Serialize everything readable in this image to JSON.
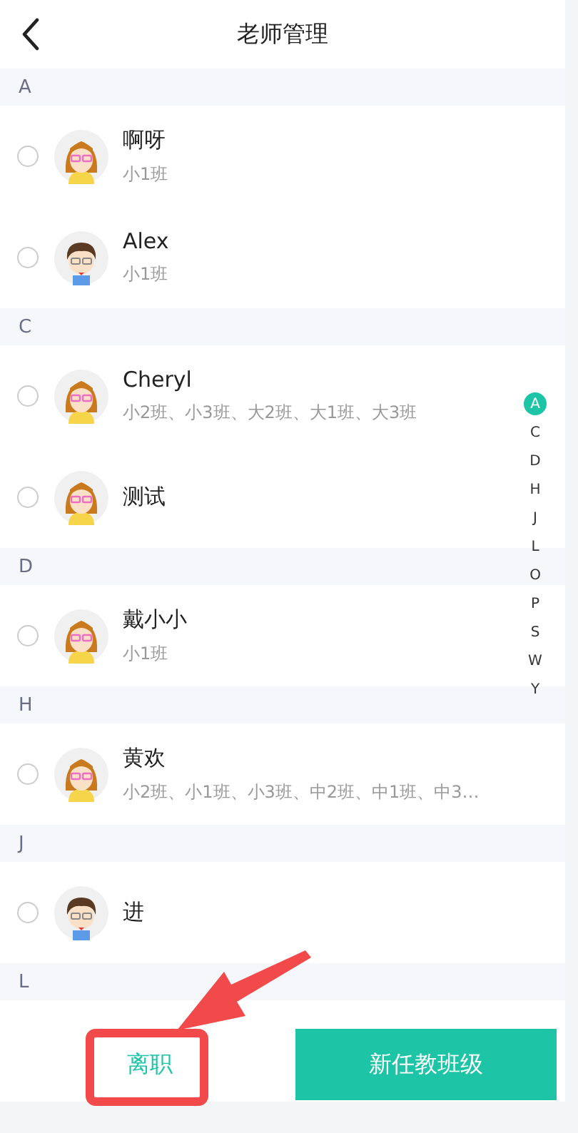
{
  "header": {
    "title": "老师管理"
  },
  "sections": [
    {
      "letter": "A",
      "teachers": [
        {
          "name": "啊呀",
          "classes": "小1班",
          "kind": "female",
          "checked": false
        },
        {
          "name": "Alex",
          "classes": "小1班",
          "kind": "male",
          "checked": false
        }
      ]
    },
    {
      "letter": "C",
      "teachers": [
        {
          "name": "Cheryl",
          "classes": "小2班、小3班、大2班、大1班、大3班",
          "kind": "female",
          "checked": false
        },
        {
          "name": "测试",
          "kind": "female",
          "checked": false
        }
      ]
    },
    {
      "letter": "D",
      "teachers": [
        {
          "name": "戴小小",
          "classes": "小1班",
          "kind": "female",
          "checked": false
        }
      ]
    },
    {
      "letter": "H",
      "teachers": [
        {
          "name": "黄欢",
          "classes": "小2班、小1班、小3班、中2班、中1班、中3…",
          "kind": "female",
          "checked": false
        }
      ]
    },
    {
      "letter": "J",
      "teachers": [
        {
          "name": "进",
          "kind": "male",
          "checked": false
        }
      ]
    },
    {
      "letter": "L"
    }
  ],
  "index": [
    {
      "letter": "A",
      "selected": true
    },
    {
      "letter": "C",
      "selected": false
    },
    {
      "letter": "D",
      "selected": false
    },
    {
      "letter": "H",
      "selected": false
    },
    {
      "letter": "J",
      "selected": false
    },
    {
      "letter": "L",
      "selected": false
    },
    {
      "letter": "O",
      "selected": false
    },
    {
      "letter": "P",
      "selected": false
    },
    {
      "letter": "S",
      "selected": false
    },
    {
      "letter": "W",
      "selected": false
    },
    {
      "letter": "Y",
      "selected": false
    }
  ],
  "buttons": [
    {
      "label": "离职",
      "kind": "text"
    },
    {
      "label": "新任教班级",
      "kind": "primary"
    }
  ],
  "annotation": {
    "arrow": true,
    "highlight_box": true
  }
}
